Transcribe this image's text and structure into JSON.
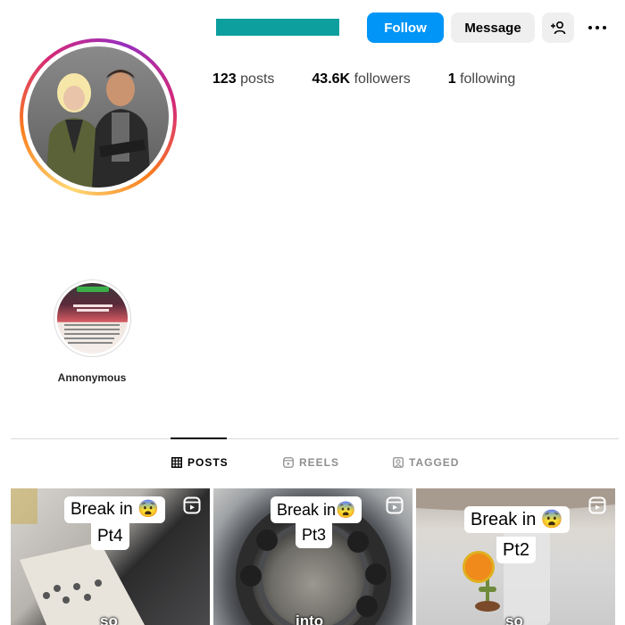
{
  "header": {
    "follow_label": "Follow",
    "message_label": "Message",
    "username_bar_color": "#0d9e9e",
    "icons": [
      "add-user-icon",
      "more-options-icon"
    ]
  },
  "stats": {
    "posts_count": "123",
    "posts_label": "posts",
    "followers_count": "43.6K",
    "followers_label": "followers",
    "following_count": "1",
    "following_label": "following"
  },
  "highlights": [
    {
      "label": "Annonymous"
    }
  ],
  "tabs": [
    {
      "label": "POSTS",
      "active": true,
      "icon": "grid-icon"
    },
    {
      "label": "REELS",
      "active": false,
      "icon": "reels-icon"
    },
    {
      "label": "TAGGED",
      "active": false,
      "icon": "tagged-icon"
    }
  ],
  "posts": [
    {
      "caption_line1": "Break in 😨",
      "caption_line2": "Pt4",
      "bottom_text": "so",
      "type_icon": "reel-icon"
    },
    {
      "caption_line1": "Break in😨",
      "caption_line2": "Pt3",
      "bottom_text": "into",
      "type_icon": "reel-icon"
    },
    {
      "caption_line1": "Break in 😨",
      "caption_line2": "Pt2",
      "bottom_text": "so",
      "type_icon": "reel-icon"
    }
  ],
  "colors": {
    "accent": "#0095f6",
    "button_gray": "#efefef",
    "divider": "#dbdbdb"
  }
}
